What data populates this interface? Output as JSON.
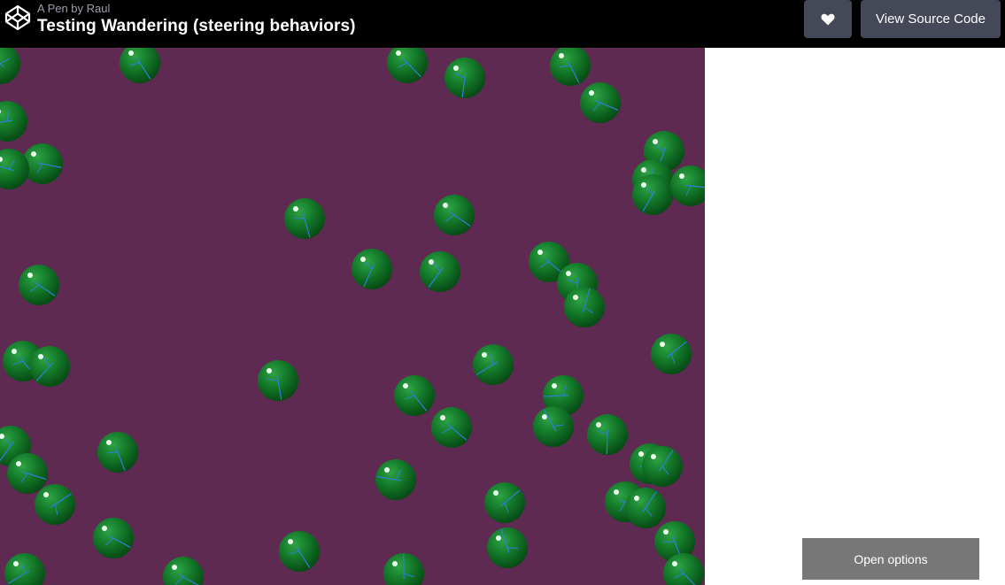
{
  "header": {
    "byline": "A Pen by Raul",
    "title": "Testing Wandering (steering behaviors)",
    "view_source_label": "View Source Code",
    "logo_icon": "codepen-icon",
    "heart_icon": "heart-icon"
  },
  "canvas": {
    "background": "#5e2a52",
    "ball_color": "#0f7a25",
    "ball_highlight": "#eaffea",
    "velocity_line_color": "#2f7fd9"
  },
  "footer": {
    "options_label": "Open options"
  }
}
